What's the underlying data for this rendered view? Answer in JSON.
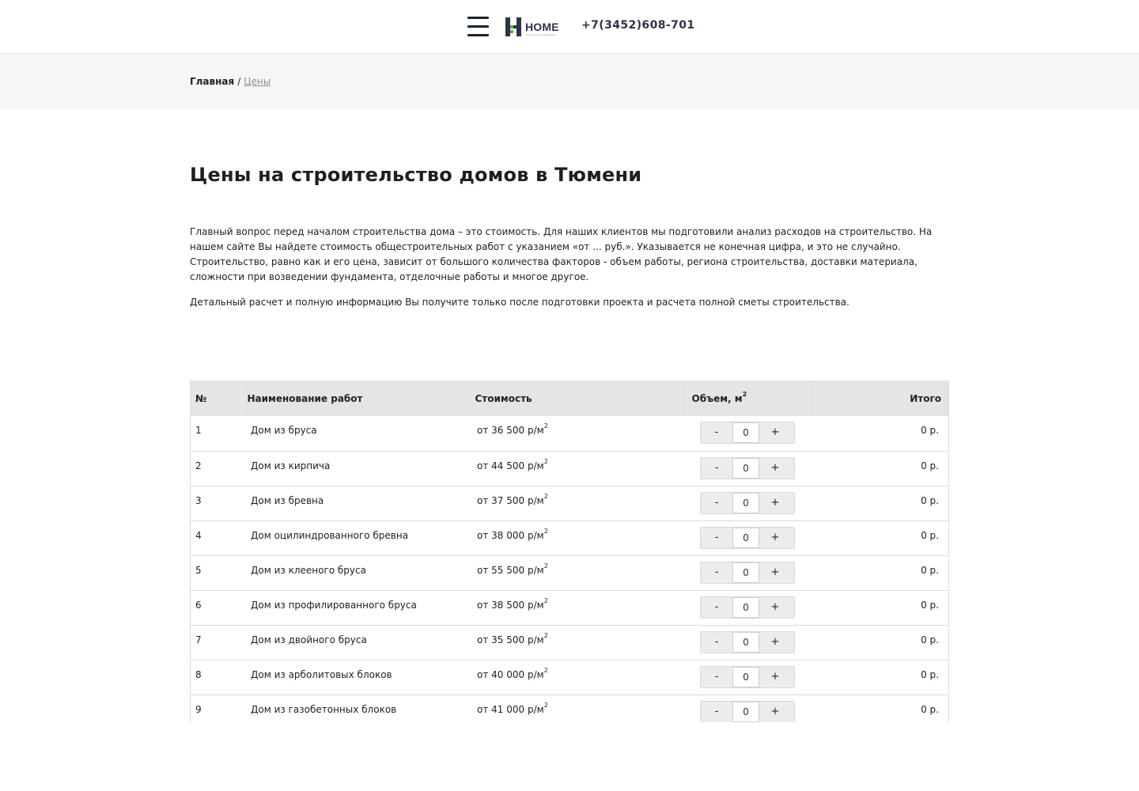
{
  "header": {
    "logo_word": "HOME",
    "logo_sub": "строительная компания",
    "phone": "+7(3452)608-701"
  },
  "breadcrumb": {
    "home": "Главная",
    "separator": "/",
    "current": "Цены"
  },
  "page": {
    "title": "Цены на строительство домов в Тюмени",
    "intro": "Главный вопрос перед началом строительства дома – это стоимость. Для наших клиентов мы подготовили анализ расходов на строительство. На нашем сайте Вы найдете стоимость общестроительных работ с указанием «от ... руб.». Указывается не конечная цифра, и это не случайно. Строительство, равно как и его цена, зависит от большого количества факторов - объем работы, региона строительства, доставки материала, сложности при возведении фундамента, отделочные работы и многое другое.",
    "intro2": "Детальный расчет и полную информацию Вы получите только после подготовки проекта и расчета полной сметы строительства."
  },
  "table": {
    "headers": {
      "num": "№",
      "name": "Наименование работ",
      "price": "Стоимость",
      "volume": "Объем, м",
      "volume_sup": "2",
      "total": "Итого"
    },
    "price_unit": "р/м",
    "price_unit_sup": "2",
    "minus": "-",
    "plus": "+",
    "rows": [
      {
        "num": "1",
        "name": "Дом из бруса",
        "price": "от 36 500",
        "qty": "0",
        "total": "0 р."
      },
      {
        "num": "2",
        "name": "Дом из кирпича",
        "price": "от 44 500",
        "qty": "0",
        "total": "0 р."
      },
      {
        "num": "3",
        "name": "Дом из бревна",
        "price": "от 37 500",
        "qty": "0",
        "total": "0 р."
      },
      {
        "num": "4",
        "name": "Дом оцилиндрованного бревна",
        "price": "от 38 000",
        "qty": "0",
        "total": "0 р."
      },
      {
        "num": "5",
        "name": "Дом из клееного бруса",
        "price": "от 55 500",
        "qty": "0",
        "total": "0 р."
      },
      {
        "num": "6",
        "name": "Дом из профилированного бруса",
        "price": "от 38 500",
        "qty": "0",
        "total": "0 р."
      },
      {
        "num": "7",
        "name": "Дом из двойного бруса",
        "price": "от 35 500",
        "qty": "0",
        "total": "0 р."
      },
      {
        "num": "8",
        "name": "Дом из арболитовых блоков",
        "price": "от 40 000",
        "qty": "0",
        "total": "0 р."
      },
      {
        "num": "9",
        "name": "Дом из газобетонных блоков",
        "price": "от 41 000",
        "qty": "0",
        "total": "0 р."
      }
    ]
  }
}
